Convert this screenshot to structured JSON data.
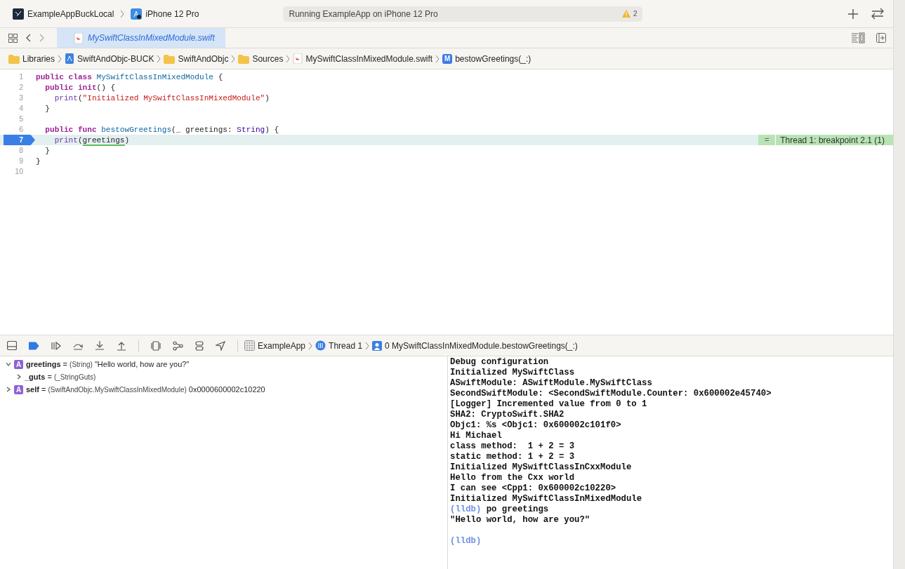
{
  "toolbar": {
    "scheme": "ExampleAppBuckLocal",
    "device": "iPhone 12 Pro",
    "status": "Running ExampleApp on iPhone 12 Pro",
    "warning_count": "2"
  },
  "tabs": [
    {
      "label": "MySwiftClassInMixedModule.swift",
      "selected": true
    }
  ],
  "jump_bar": [
    {
      "kind": "folder",
      "label": "Libraries"
    },
    {
      "kind": "project",
      "label": "SwiftAndObjc-BUCK"
    },
    {
      "kind": "folder",
      "label": "SwiftAndObjc"
    },
    {
      "kind": "folder",
      "label": "Sources"
    },
    {
      "kind": "swift",
      "label": "MySwiftClassInMixedModule.swift"
    },
    {
      "kind": "method",
      "badge": "M",
      "label": "bestowGreetings(_:)"
    }
  ],
  "editor": {
    "lines": [
      {
        "number": "1",
        "current": false,
        "tokens": [
          {
            "kind": "kw",
            "text": "public class "
          },
          {
            "kind": "decl",
            "text": "MySwiftClassInMixedModule"
          },
          {
            "kind": "plain",
            "text": " {"
          }
        ]
      },
      {
        "number": "2",
        "current": false,
        "tokens": [
          {
            "kind": "kw",
            "text": "  public init"
          },
          {
            "kind": "plain",
            "text": "() {"
          }
        ]
      },
      {
        "number": "3",
        "current": false,
        "tokens": [
          {
            "kind": "call",
            "text": "    print"
          },
          {
            "kind": "plain",
            "text": "("
          },
          {
            "kind": "string",
            "text": "\"Initialized MySwiftClassInMixedModule\""
          },
          {
            "kind": "plain",
            "text": ")"
          }
        ]
      },
      {
        "number": "4",
        "current": false,
        "tokens": [
          {
            "kind": "plain",
            "text": "  }"
          }
        ]
      },
      {
        "number": "5",
        "current": false
      },
      {
        "number": "6",
        "current": false,
        "tokens": [
          {
            "kind": "kw",
            "text": "  public func "
          },
          {
            "kind": "decl",
            "text": "bestowGreetings"
          },
          {
            "kind": "plain",
            "text": "("
          },
          {
            "kind": "kw",
            "text": "_"
          },
          {
            "kind": "plain",
            "text": " greetings: "
          },
          {
            "kind": "type",
            "text": "String"
          },
          {
            "kind": "plain",
            "text": ") {"
          }
        ]
      },
      {
        "number": "7",
        "current": true,
        "tokens": [
          {
            "kind": "call",
            "text": "    print"
          },
          {
            "kind": "plain",
            "text": "("
          },
          {
            "kind": "underlined",
            "text": "greetings"
          },
          {
            "kind": "plain",
            "text": ")"
          }
        ]
      },
      {
        "number": "8",
        "current": false,
        "tokens": [
          {
            "kind": "plain",
            "text": "  }"
          }
        ]
      },
      {
        "number": "9",
        "current": false,
        "tokens": [
          {
            "kind": "plain",
            "text": "}"
          }
        ]
      },
      {
        "number": "10",
        "current": false
      }
    ],
    "annotation": {
      "symbol": "=",
      "text": "Thread 1: breakpoint 2.1 (1)"
    }
  },
  "debug_bar": {
    "breakpoints_active": true,
    "path": [
      {
        "kind": "app",
        "label": "ExampleApp"
      },
      {
        "kind": "thread",
        "label": "Thread 1"
      },
      {
        "kind": "frame",
        "label": "0 MySwiftClassInMixedModule.bestowGreetings(_:)"
      }
    ]
  },
  "variables": [
    {
      "badge": "A",
      "name": "greetings",
      "sign": "=",
      "type": "(String)",
      "value": "\"Hello world, how are you?\"",
      "expanded": true,
      "children": [
        {
          "name": "_guts",
          "sign": "=",
          "type": "(_StringGuts)",
          "expanded": false
        }
      ]
    },
    {
      "badge": "A",
      "name": "self",
      "sign": "=",
      "type": "(SwiftAndObjc.MySwiftClassInMixedModule)",
      "value": "0x0000600002c10220",
      "expanded": false
    }
  ],
  "console": [
    {
      "kind": "output",
      "text": "Debug configuration"
    },
    {
      "kind": "output",
      "text": "Initialized MySwiftClass"
    },
    {
      "kind": "output",
      "text": "ASwiftModule: ASwiftModule.MySwiftClass"
    },
    {
      "kind": "output",
      "text": "SecondSwiftModule: <SecondSwiftModule.Counter: 0x600002e45740>"
    },
    {
      "kind": "output",
      "text": "[Logger] Incremented value from 0 to 1"
    },
    {
      "kind": "output",
      "text": "SHA2: CryptoSwift.SHA2"
    },
    {
      "kind": "output",
      "text": "Objc1: %s <Objc1: 0x600002c101f0>"
    },
    {
      "kind": "output",
      "text": "Hi Michael"
    },
    {
      "kind": "output",
      "text": "class method:  1 + 2 = 3"
    },
    {
      "kind": "output",
      "text": "static method: 1 + 2 = 3"
    },
    {
      "kind": "output",
      "text": "Initialized MySwiftClassInCxxModule"
    },
    {
      "kind": "output",
      "text": "Hello from the Cxx world"
    },
    {
      "kind": "output",
      "text": "I can see <Cpp1: 0x600002c10220>"
    },
    {
      "kind": "output",
      "text": "Initialized MySwiftClassInMixedModule"
    },
    {
      "kind": "prompt",
      "prompt": "(lldb)",
      "text": "po greetings"
    },
    {
      "kind": "output",
      "text": "\"Hello world, how are you?\""
    },
    {
      "kind": "blank"
    },
    {
      "kind": "prompt",
      "prompt": "(lldb)"
    }
  ]
}
